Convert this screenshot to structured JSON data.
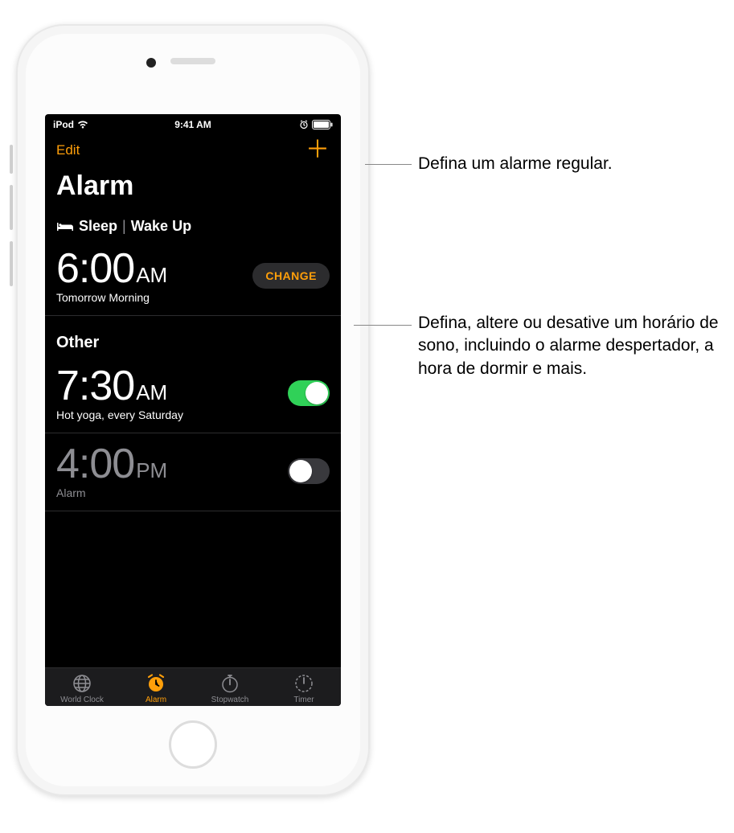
{
  "statusBar": {
    "carrier": "iPod",
    "time": "9:41 AM"
  },
  "nav": {
    "edit": "Edit",
    "title": "Alarm"
  },
  "sleepSection": {
    "label_sleep": "Sleep",
    "label_wake": "Wake Up",
    "time": "6:00",
    "period": "AM",
    "sub": "Tomorrow Morning",
    "change": "CHANGE"
  },
  "otherSection": {
    "title": "Other",
    "alarms": [
      {
        "time": "7:30",
        "period": "AM",
        "label": "Hot yoga, every Saturday",
        "on": true
      },
      {
        "time": "4:00",
        "period": "PM",
        "label": "Alarm",
        "on": false
      }
    ]
  },
  "tabs": {
    "worldClock": "World Clock",
    "alarm": "Alarm",
    "stopwatch": "Stopwatch",
    "timer": "Timer"
  },
  "callouts": {
    "c1": "Defina um alarme regular.",
    "c2": "Defina, altere ou desative um horário de sono, incluindo o alarme despertador, a hora de dormir e mais."
  }
}
